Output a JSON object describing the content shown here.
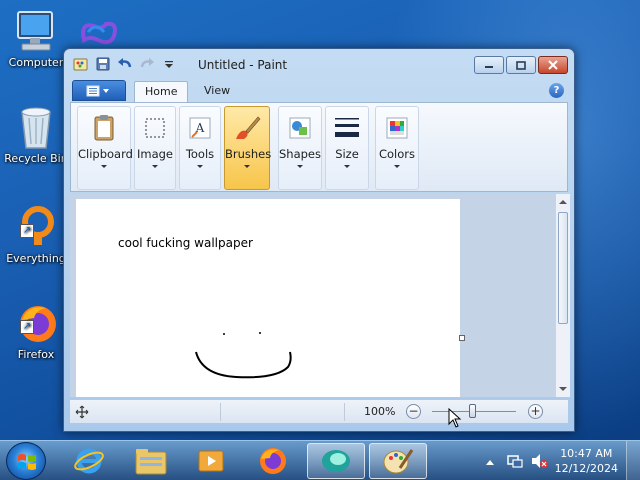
{
  "desktop": {
    "icons": [
      {
        "label": "Computer"
      },
      {
        "label": "Recycle Bin"
      },
      {
        "label": "Everything"
      },
      {
        "label": "Firefox"
      }
    ]
  },
  "window": {
    "title": "Untitled - Paint",
    "tabs": [
      {
        "label": "Home"
      },
      {
        "label": "View"
      }
    ],
    "help": "?",
    "ribbon": [
      {
        "label": "Clipboard"
      },
      {
        "label": "Image"
      },
      {
        "label": "Tools"
      },
      {
        "label": "Brushes",
        "selected": true
      },
      {
        "label": "Shapes"
      },
      {
        "label": "Size"
      },
      {
        "label": "Colors"
      }
    ],
    "canvas": {
      "text": "cool fucking wallpaper"
    },
    "status": {
      "zoom": "100%",
      "zoom_minus": "−",
      "zoom_plus": "+"
    }
  },
  "taskbar": {
    "time": "10:47 AM",
    "date": "12/12/2024"
  },
  "colors": {
    "accent": "#1f5fb9",
    "selected_group": "#f7c54a",
    "close_button": "#c7452b"
  }
}
